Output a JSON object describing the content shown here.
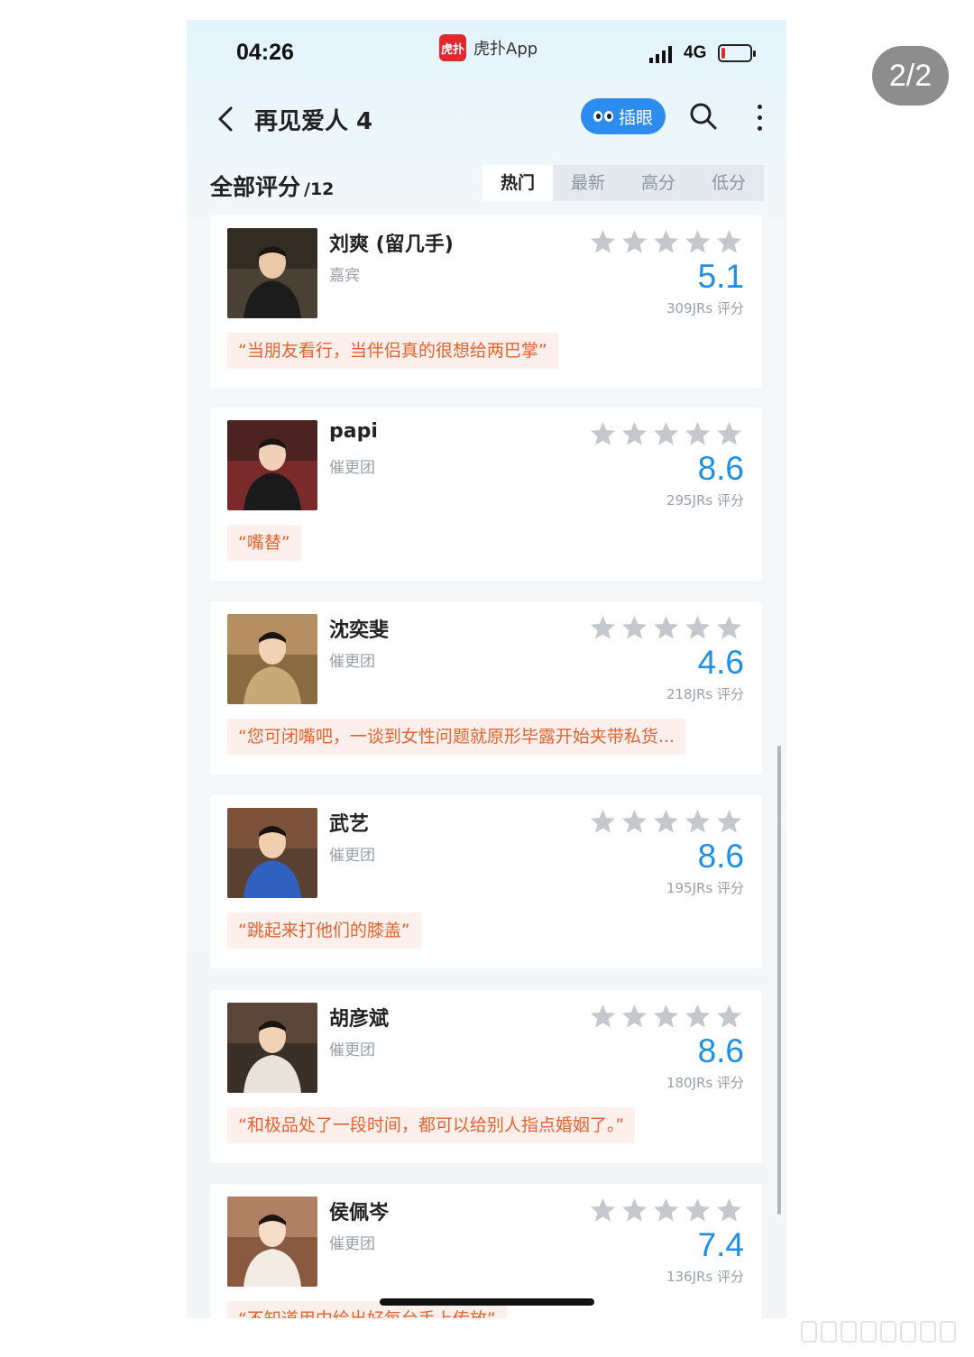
{
  "overlay": {
    "page_counter": "2/2"
  },
  "status_bar": {
    "time": "04:26",
    "app_logo_text": "虎扑",
    "app_name": "虎扑App",
    "network": "4G"
  },
  "nav": {
    "title": "再见爱人 4",
    "eye_button_label": "插眼"
  },
  "ratings": {
    "title": "全部评分",
    "count": "/12",
    "tabs": [
      "热门",
      "最新",
      "高分",
      "低分"
    ],
    "active_tab": "热门",
    "star_color": "#c4c8cd",
    "score_color": "#1e8fe8",
    "quote_color": "#e4632e",
    "items": [
      {
        "name": "刘爽 (留几手)",
        "role": "嘉宾",
        "score": "5.1",
        "votes": "309JRs 评分",
        "quote": "“当朋友看行，当伴侣真的很想给两巴掌”"
      },
      {
        "name": "papi",
        "role": "催更团",
        "score": "8.6",
        "votes": "295JRs 评分",
        "quote": "“嘴替”"
      },
      {
        "name": "沈奕斐",
        "role": "催更团",
        "score": "4.6",
        "votes": "218JRs 评分",
        "quote": "“您可闭嘴吧，一谈到女性问题就原形毕露开始夹带私货..."
      },
      {
        "name": "武艺",
        "role": "催更团",
        "score": "8.6",
        "votes": "195JRs 评分",
        "quote": "“跳起来打他们的膝盖”"
      },
      {
        "name": "胡彦斌",
        "role": "催更团",
        "score": "8.6",
        "votes": "180JRs 评分",
        "quote": "“和极品处了一段时间，都可以给别人指点婚姻了。”"
      },
      {
        "name": "侯佩岑",
        "role": "催更团",
        "score": "7.4",
        "votes": "136JRs 评分",
        "quote": "“不知道用中绘出好每台手上传放”"
      }
    ]
  }
}
